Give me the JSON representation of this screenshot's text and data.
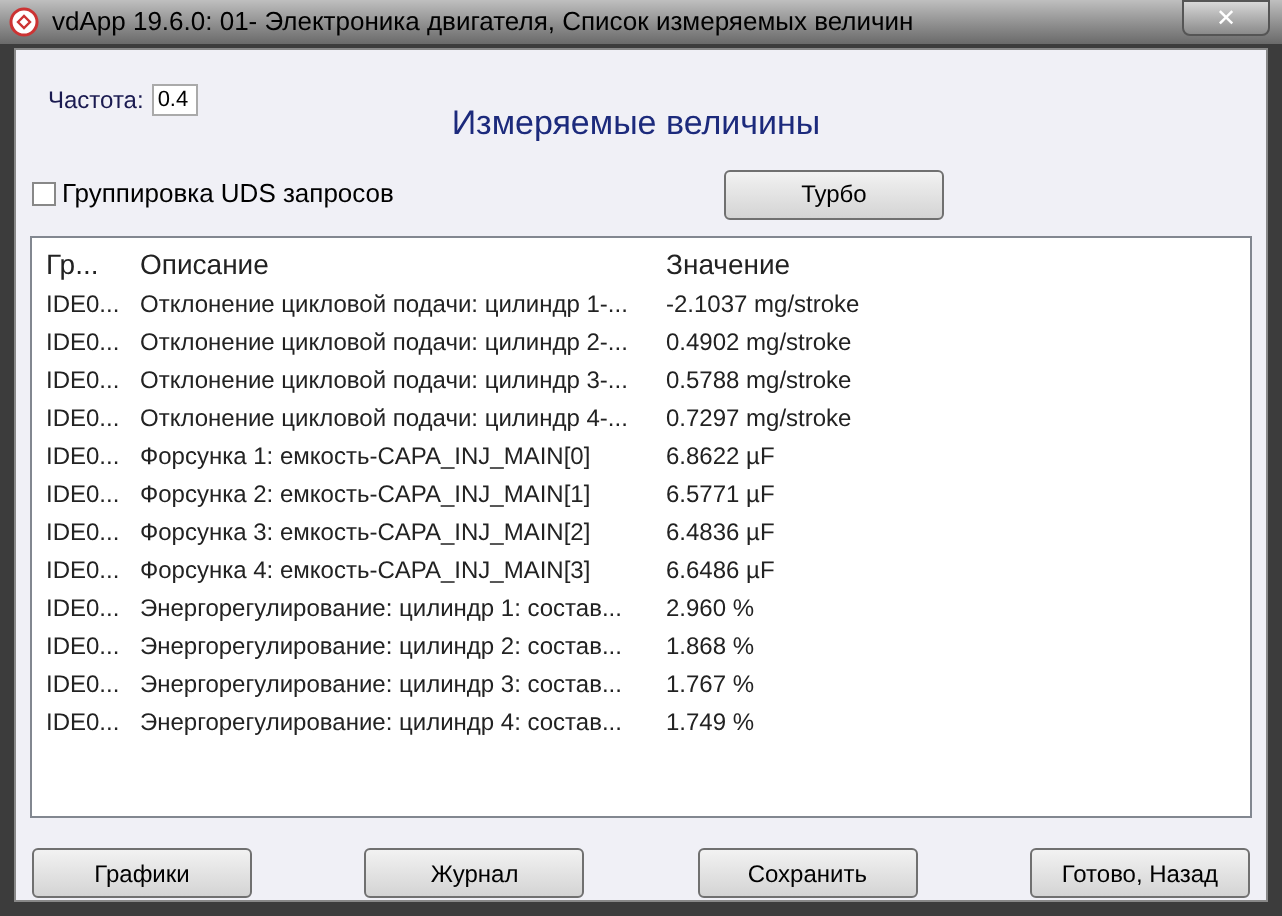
{
  "window": {
    "title": "vdApp 19.6.0: 01- Электроника двигателя,  Список измеряемых величин",
    "close": "✕"
  },
  "frequency": {
    "label": "Частота:",
    "value": "0.4"
  },
  "heading": "Измеряемые величины",
  "uds_grouping": {
    "label": "Группировка UDS запросов",
    "checked": false
  },
  "turbo_button": "Турбо",
  "table": {
    "columns": [
      "Гр...",
      "Описание",
      "Значение"
    ],
    "rows": [
      [
        "IDE0...",
        "Отклонение цикловой подачи: цилиндр 1-...",
        "-2.1037 mg/stroke"
      ],
      [
        "IDE0...",
        "Отклонение цикловой подачи: цилиндр 2-...",
        "0.4902 mg/stroke"
      ],
      [
        "IDE0...",
        "Отклонение цикловой подачи: цилиндр 3-...",
        "0.5788 mg/stroke"
      ],
      [
        "IDE0...",
        "Отклонение цикловой подачи: цилиндр 4-...",
        "0.7297 mg/stroke"
      ],
      [
        "IDE0...",
        "Форсунка 1: емкость-CAPA_INJ_MAIN[0]",
        "6.8622 µF"
      ],
      [
        "IDE0...",
        "Форсунка 2: емкость-CAPA_INJ_MAIN[1]",
        "6.5771 µF"
      ],
      [
        "IDE0...",
        "Форсунка 3: емкость-CAPA_INJ_MAIN[2]",
        "6.4836 µF"
      ],
      [
        "IDE0...",
        "Форсунка 4: емкость-CAPA_INJ_MAIN[3]",
        "6.6486 µF"
      ],
      [
        "IDE0...",
        "Энергорегулирование: цилиндр 1: состав...",
        "2.960 %"
      ],
      [
        "IDE0...",
        "Энергорегулирование: цилиндр 2: состав...",
        "1.868 %"
      ],
      [
        "IDE0...",
        "Энергорегулирование: цилиндр 3: состав...",
        "1.767 %"
      ],
      [
        "IDE0...",
        "Энергорегулирование: цилиндр 4: состав...",
        "1.749 %"
      ]
    ]
  },
  "buttons": [
    "Графики",
    "Журнал",
    "Сохранить",
    "Готово, Назад"
  ]
}
